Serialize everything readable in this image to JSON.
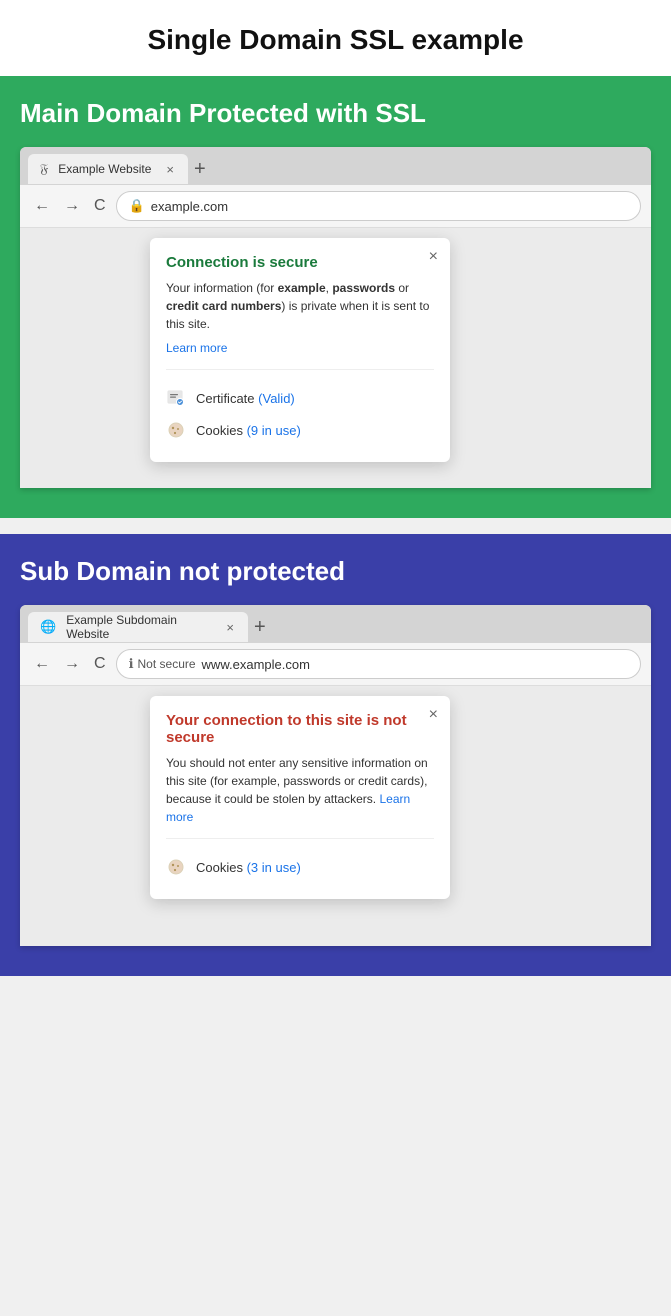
{
  "page": {
    "title": "Single Domain SSL example"
  },
  "section_secure": {
    "heading": "Main Domain Protected with SSL",
    "tab": {
      "favicon": "🔒",
      "label": "Example Website",
      "close": "×",
      "new_tab": "+"
    },
    "address": {
      "lock": "🔒",
      "url": "example.com"
    },
    "popup": {
      "title": "Connection is secure",
      "description": "Your information (for example, passwords or credit card numbers) is private when it is sent to this site.",
      "learn_more": "Learn more",
      "certificate_label": "Certificate",
      "certificate_status": "(Valid)",
      "cookies_label": "Cookies",
      "cookies_status": "(9 in use)"
    },
    "nav": {
      "back": "←",
      "forward": "→",
      "reload": "C"
    }
  },
  "section_insecure": {
    "heading": "Sub Domain not protected",
    "tab": {
      "favicon": "🌐",
      "label": "Example Subdomain Website",
      "close": "×",
      "new_tab": "+"
    },
    "address": {
      "info_icon": "ℹ",
      "not_secure": "Not secure",
      "url": "www.example.com"
    },
    "popup": {
      "title": "Your connection to this site is not secure",
      "description": "You should not enter any sensitive information on this site (for example, passwords or credit cards), because it could be stolen by attackers.",
      "learn_more": "Learn more",
      "cookies_label": "Cookies",
      "cookies_status": "(3 in use)"
    },
    "nav": {
      "back": "←",
      "forward": "→",
      "reload": "C"
    }
  }
}
